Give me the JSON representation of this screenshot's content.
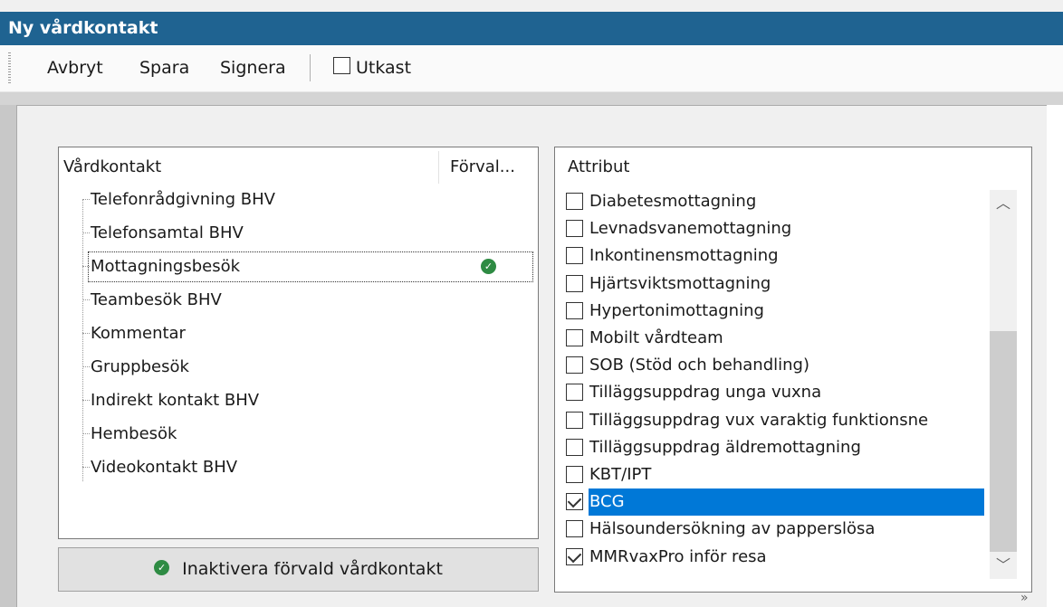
{
  "window": {
    "title": "Ny vårdkontakt"
  },
  "toolbar": {
    "cancel_label": "Avbryt",
    "save_label": "Spara",
    "sign_label": "Signera",
    "draft_label": "Utkast",
    "draft_checked": false
  },
  "left_panel": {
    "col_header_name": "Vårdkontakt",
    "col_header_default": "Förval...",
    "items": [
      {
        "label": "Telefonrådgivning BHV",
        "default": false
      },
      {
        "label": "Telefonsamtal BHV",
        "default": false
      },
      {
        "label": "Mottagningsbesök",
        "default": true,
        "selected": true
      },
      {
        "label": "Teambesök BHV",
        "default": false
      },
      {
        "label": "Kommentar",
        "default": false
      },
      {
        "label": "Gruppbesök",
        "default": false
      },
      {
        "label": "Indirekt kontakt BHV",
        "default": false
      },
      {
        "label": "Hembesök",
        "default": false
      },
      {
        "label": "Videokontakt BHV",
        "default": false
      }
    ]
  },
  "deactivate_button": {
    "label": "Inaktivera förvald vårdkontakt"
  },
  "right_panel": {
    "header": "Attribut",
    "items": [
      {
        "label": "Diabetesmottagning",
        "checked": false
      },
      {
        "label": "Levnadsvanemottagning",
        "checked": false
      },
      {
        "label": "Inkontinensmottagning",
        "checked": false
      },
      {
        "label": "Hjärtsviktsmottagning",
        "checked": false
      },
      {
        "label": "Hypertonimottagning",
        "checked": false
      },
      {
        "label": "Mobilt vårdteam",
        "checked": false
      },
      {
        "label": "SOB (Stöd och behandling)",
        "checked": false
      },
      {
        "label": "Tilläggsuppdrag unga vuxna",
        "checked": false
      },
      {
        "label": "Tilläggsuppdrag vux varaktig funktionsne",
        "checked": false
      },
      {
        "label": "Tilläggsuppdrag äldremottagning",
        "checked": false
      },
      {
        "label": "KBT/IPT",
        "checked": false
      },
      {
        "label": "BCG",
        "checked": true,
        "selected": true
      },
      {
        "label": "Hälsoundersökning av papperslösa",
        "checked": false
      },
      {
        "label": "MMRvaxPro inför resa",
        "checked": true
      }
    ]
  },
  "icons": {
    "default_marker": "check-circle-icon",
    "scroll_up": "chevron-up-icon",
    "scroll_down": "chevron-down-icon",
    "more": "double-chevron-down-icon"
  },
  "colors": {
    "titlebar": "#1f6391",
    "selection": "#0078d7",
    "ok_badge": "#2e8b43"
  }
}
